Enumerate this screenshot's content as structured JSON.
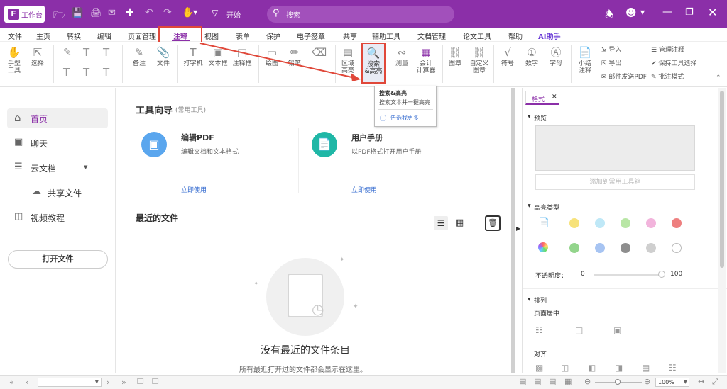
{
  "titlebar": {
    "home_label": "工作台",
    "start_label": "开始",
    "search_placeholder": "搜索"
  },
  "menu": [
    "文件",
    "主页",
    "转换",
    "编辑",
    "页面管理",
    "注释",
    "视图",
    "表单",
    "保护",
    "电子签章",
    "共享",
    "辅助工具",
    "文档管理",
    "论文工具",
    "帮助",
    "AI助手"
  ],
  "ribbon": {
    "hand_tool": "手型\n工具",
    "select": "选择",
    "note": "备注",
    "file": "文件",
    "typewriter": "打字机",
    "textbox": "文本框",
    "callout": "注释框",
    "drawing": "绘图",
    "pencil": "铅笔",
    "area_highlight": "区域\n高亮",
    "search_highlight": "搜索\n&高亮",
    "measure": "测量",
    "calculator": "会计\n计算器",
    "stamp": "图章",
    "custom_stamp": "自定义\n图章",
    "symbol": "符号",
    "number": "数字",
    "letter": "字母",
    "summary": "小结\n注释",
    "import": "导入",
    "export": "导出",
    "email": "邮件发送PDF",
    "manage": "管理注释",
    "keep_tool": "保持工具选择",
    "batch_mode": "批注模式"
  },
  "tooltip": {
    "title": "搜索&高亮",
    "desc": "搜索文本并一键高亮",
    "more": "告诉我更多"
  },
  "sidebar": {
    "items": [
      "首页",
      "聊天",
      "云文档",
      "共享文件",
      "视频教程"
    ],
    "open_file": "打开文件"
  },
  "main": {
    "guide_title": "工具向导",
    "guide_sub": "(常用工具)",
    "tools": [
      {
        "title": "编辑PDF",
        "desc": "编辑文档和文本格式",
        "action": "立即使用"
      },
      {
        "title": "用户手册",
        "desc": "以PDF格式打开用户手册",
        "action": "立即使用"
      }
    ],
    "recent_title": "最近的文件",
    "empty_title": "没有最近的文件条目",
    "empty_desc": "所有最近打开过的文件都会显示在这里。"
  },
  "rightpanel": {
    "tab": "格式",
    "preview": "预览",
    "add_tool": "添加到常用工具箱",
    "highlight_type": "高亮类型",
    "opacity_label": "不透明度：",
    "opacity_min": "0",
    "opacity_max": "100",
    "opacity_value": 1.0,
    "arrange": "排列",
    "page_center": "页面居中",
    "align": "对齐",
    "colors": [
      "#f7e27a",
      "#bfe8f7",
      "#b8e6a5",
      "#f2b4dc",
      "#ee7f7f",
      "#93d58c",
      "#a7c4f2",
      "#8e8e8e",
      "#cfcfcf",
      "#ffffff"
    ]
  },
  "statusbar": {
    "zoom": "100%"
  }
}
